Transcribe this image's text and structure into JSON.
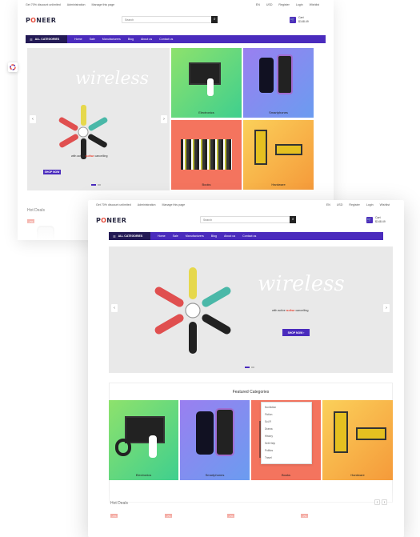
{
  "topbar": {
    "promo": "Get 70% discount unlimited",
    "admin": "Administration",
    "manage": "Manage this page",
    "lang": "EN",
    "currency": "USD",
    "register": "Register",
    "login": "Login",
    "wishlist": "Wishlist"
  },
  "header": {
    "logo_prefix": "P",
    "logo_o": "O",
    "logo_suffix": "NEER",
    "search_placeholder": "Search",
    "cart_label": "Cart",
    "cart_amount": "$148.49"
  },
  "nav": {
    "categories_label": "ALL CATEGORIES",
    "items": [
      "Home",
      "Sale",
      "Manufacturers",
      "Blog",
      "About us",
      "Contact us"
    ]
  },
  "hero": {
    "headline": "wireless",
    "tagline_prefix": "with active",
    "tagline_emph": "noise",
    "tagline_suffix": "cancelling",
    "cta": "SHOP NOW"
  },
  "categories": {
    "title": "Featured Categories",
    "items": [
      "Electronics",
      "Smartphones",
      "Books",
      "Hardware"
    ]
  },
  "dropdown_items": [
    "Nonfiction",
    "Fiction",
    "Sci-Fi",
    "Drama",
    "History",
    "Self-Help",
    "Politics",
    "Travel"
  ],
  "hot_deals": {
    "title": "Hot Deals",
    "badge": "-7%"
  },
  "colors": {
    "brand": "#4a2bbd",
    "brand_dark": "#231a55",
    "accent": "#e74c3c",
    "electronics_bg": "#5ad26a",
    "smartphones_bg": "#7f8af0",
    "books_bg": "#f47a6a",
    "hardware_bg": "#f7b34a"
  }
}
